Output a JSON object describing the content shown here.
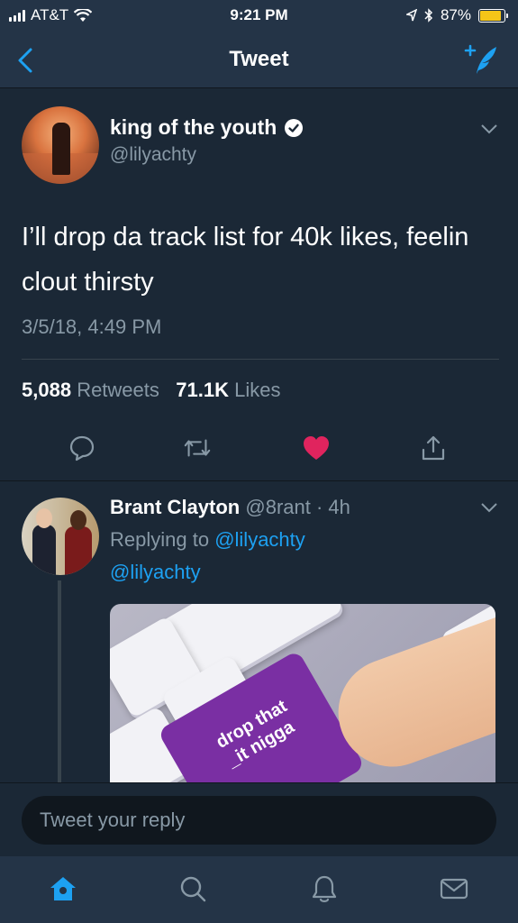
{
  "status_bar": {
    "carrier": "AT&T",
    "time": "9:21 PM",
    "battery": "87%",
    "battery_level": 0.87
  },
  "nav": {
    "title": "Tweet",
    "back_icon": "chevron-left-icon",
    "compose_icon": "compose-tweet-icon"
  },
  "main_tweet": {
    "display_name": "king of the youth",
    "handle": "@lilyachty",
    "text": "I’ll drop da track list for 40k likes, feelin clout thirsty",
    "timestamp": "3/5/18, 4:49 PM",
    "retweets_count": "5,088",
    "retweets_label": "Retweets",
    "likes_count": "71.1K",
    "likes_label": "Likes"
  },
  "reply_tweet": {
    "display_name": "Brant Clayton",
    "handle": "@8rant",
    "age": "· 4h",
    "replying_prefix": "Replying to",
    "replying_handle": "@lilyachty",
    "text": "@lilyachty",
    "media_caption": "drop that\n_it nigga"
  },
  "reply_box": {
    "placeholder": "Tweet your reply"
  },
  "colors": {
    "accent": "#1da1f2",
    "like": "#e0245e",
    "background": "#1b2836",
    "secondary_text": "#8899a6"
  }
}
